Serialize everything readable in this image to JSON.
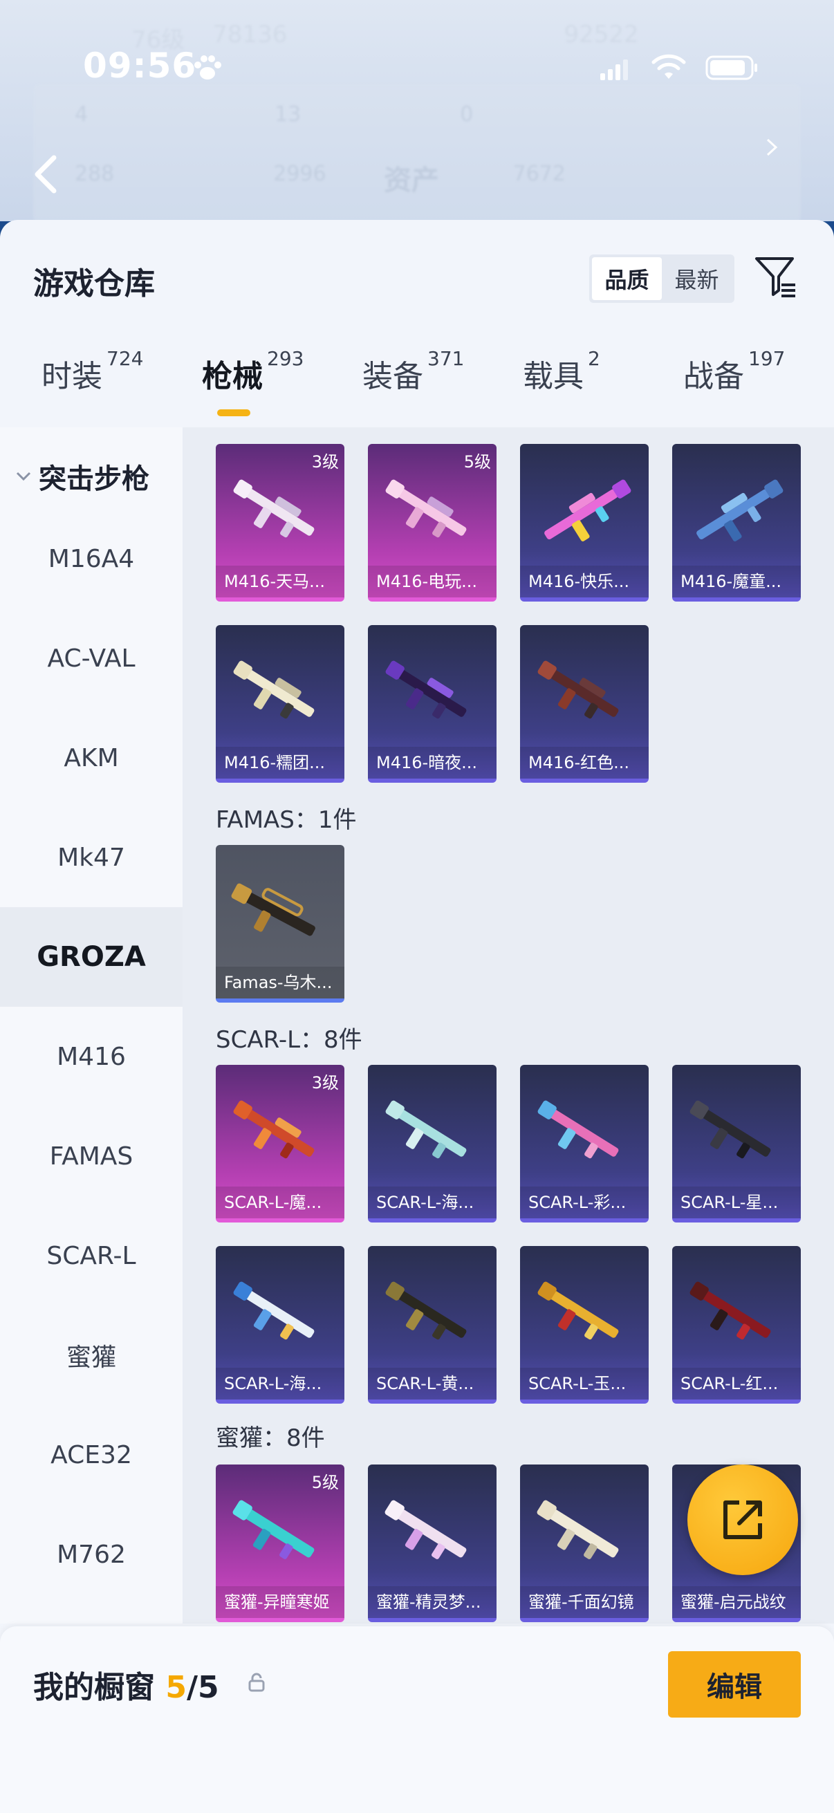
{
  "status_bar": {
    "time": "09:56"
  },
  "background_header": {
    "level": "76级",
    "views": "78136",
    "score": "92522",
    "stats_row1": [
      "4",
      "13",
      "0"
    ],
    "stats_row2": [
      "288",
      "2996",
      "7672"
    ],
    "title": "资产"
  },
  "sheet": {
    "title": "游戏仓库",
    "sort": [
      "品质",
      "最新"
    ],
    "sort_active": "品质"
  },
  "tabs": [
    {
      "label": "时装",
      "count": "724"
    },
    {
      "label": "枪械",
      "count": "293"
    },
    {
      "label": "装备",
      "count": "371"
    },
    {
      "label": "载具",
      "count": "2"
    },
    {
      "label": "战备",
      "count": "197"
    }
  ],
  "active_tab": "枪械",
  "accent_color": "#f5b315",
  "sidebar": {
    "header": "突击步枪",
    "items": [
      "M16A4",
      "AC-VAL",
      "AKM",
      "Mk47",
      "GROZA",
      "M416",
      "FAMAS",
      "SCAR-L",
      "蜜獾",
      "ACE32",
      "M762"
    ],
    "active": "GROZA"
  },
  "groups": {
    "famas_label": "FAMAS：1件",
    "scarl_label": "SCAR-L：8件",
    "honey_label": "蜜獾：8件"
  },
  "cards": {
    "m416_1": {
      "name": "M416-天马...",
      "level": "3级",
      "rarity": "pink"
    },
    "m416_2": {
      "name": "M416-电玩...",
      "level": "5级",
      "rarity": "pink"
    },
    "m416_3": {
      "name": "M416-快乐...",
      "rarity": "purple"
    },
    "m416_4": {
      "name": "M416-魔童...",
      "rarity": "purple"
    },
    "m416_5": {
      "name": "M416-糯团...",
      "rarity": "purple"
    },
    "m416_6": {
      "name": "M416-暗夜...",
      "rarity": "purple"
    },
    "m416_7": {
      "name": "M416-红色...",
      "rarity": "purple"
    },
    "famas_1": {
      "name": "Famas-乌木...",
      "rarity": "gray"
    },
    "scar_1": {
      "name": "SCAR-L-魔...",
      "level": "3级",
      "rarity": "pink"
    },
    "scar_2": {
      "name": "SCAR-L-海...",
      "rarity": "purple"
    },
    "scar_3": {
      "name": "SCAR-L-彩...",
      "rarity": "purple"
    },
    "scar_4": {
      "name": "SCAR-L-星...",
      "rarity": "purple"
    },
    "scar_5": {
      "name": "SCAR-L-海...",
      "rarity": "purple"
    },
    "scar_6": {
      "name": "SCAR-L-黄...",
      "rarity": "purple"
    },
    "scar_7": {
      "name": "SCAR-L-玉...",
      "rarity": "purple"
    },
    "scar_8": {
      "name": "SCAR-L-红...",
      "rarity": "purple"
    },
    "honey_1": {
      "name": "蜜獾-异瞳寒姬",
      "level": "5级",
      "rarity": "pink"
    },
    "honey_2": {
      "name": "蜜獾-精灵梦...",
      "rarity": "purple"
    },
    "honey_3": {
      "name": "蜜獾-千面幻镜",
      "rarity": "purple"
    },
    "honey_4": {
      "name": "蜜獾-启元战纹",
      "rarity": "purple"
    }
  },
  "bottom": {
    "label": "我的橱窗",
    "count": "5",
    "sep": "/",
    "total": "5",
    "edit": "编辑"
  },
  "icons": [
    "paw-icon",
    "signal-icon",
    "wifi-icon",
    "battery-icon",
    "back-icon",
    "filter-icon",
    "chevron-down-icon",
    "share-icon",
    "lock-icon",
    "gun-icon"
  ]
}
